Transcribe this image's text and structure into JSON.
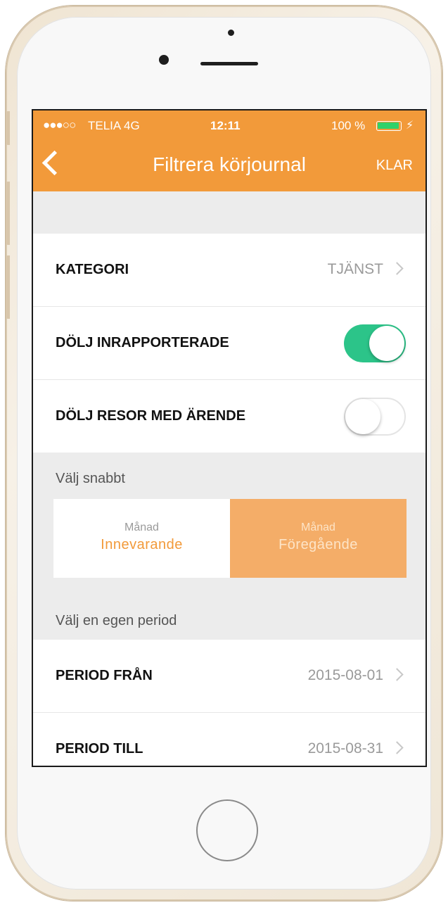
{
  "status_bar": {
    "signal": "●●●○○",
    "carrier": "TELIA  4G",
    "time": "12:11",
    "battery_text": "100 %",
    "battery_level": 1.0,
    "charging_symbol": "⚡"
  },
  "nav": {
    "title": "Filtrera körjournal",
    "done_label": "KLAR",
    "back_icon": "chevron-left-icon"
  },
  "settings": {
    "category": {
      "label": "KATEGORI",
      "value": "TJÄNST"
    },
    "hide_reported": {
      "label": "DÖLJ INRAPPORTERADE",
      "on": true
    },
    "hide_trips_with_errand": {
      "label": "DÖLJ RESOR MED ÄRENDE",
      "on": false
    }
  },
  "quick_select": {
    "header": "Välj snabbt",
    "options": [
      {
        "sub": "Månad",
        "label": "Innevarande",
        "selected": false
      },
      {
        "sub": "Månad",
        "label": "Föregående",
        "selected": true
      }
    ]
  },
  "custom_period": {
    "header": "Välj en egen period",
    "from": {
      "label": "PERIOD FRÅN",
      "value": "2015-08-01"
    },
    "to": {
      "label": "PERIOD TILL",
      "value": "2015-08-31"
    }
  },
  "colors": {
    "accent": "#f29a3a",
    "accent_light": "#f4ad68",
    "toggle_on": "#2cc489"
  }
}
